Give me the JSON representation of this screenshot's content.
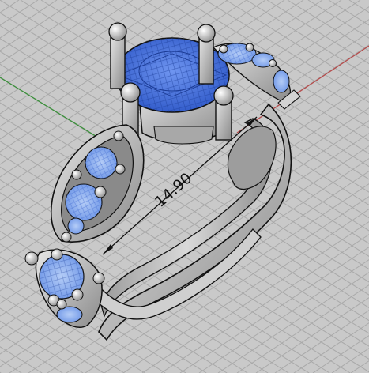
{
  "viewport": {
    "projection": "perspective",
    "background_color": "#c9c9c9",
    "grid_color": "#a9a9a9",
    "x_axis_color": "#b64a4a",
    "y_axis_color": "#3a8f3a"
  },
  "model": {
    "metal_color": "#bdbdbd",
    "gem_color": "#4a78e0",
    "side_gem_color": "#7fa8ee",
    "outline_color": "#111111"
  },
  "dimension": {
    "value": "14.90"
  }
}
